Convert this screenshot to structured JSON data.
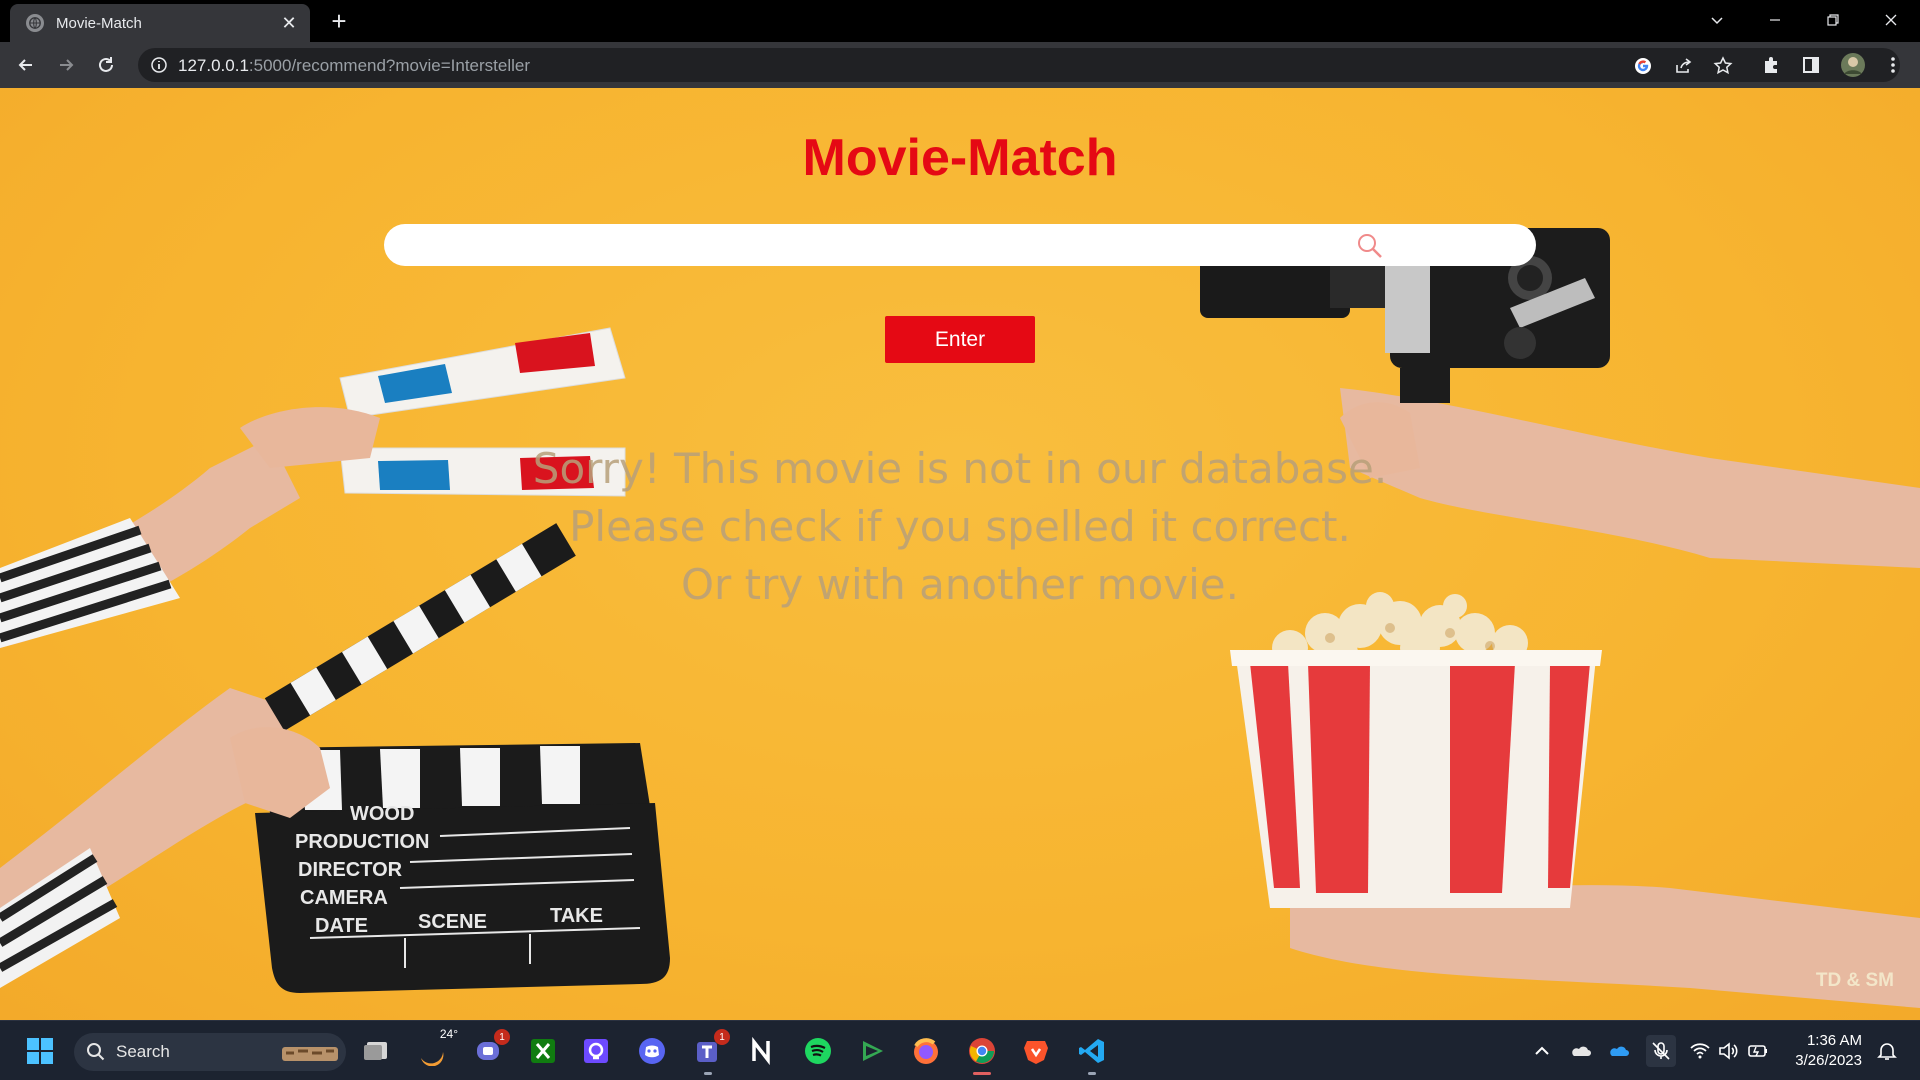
{
  "browser": {
    "tab_title": "Movie-Match",
    "url_host": "127.0.0.1",
    "url_rest": ":5000/recommend?movie=Intersteller"
  },
  "page": {
    "title": "Movie-Match",
    "search_placeholder": "",
    "search_value": "",
    "enter_label": "Enter",
    "message_line1": "Sorry! This movie is not in our database.",
    "message_line2": "Please check if you spelled it correct.",
    "message_line3": "Or try with another movie.",
    "credit": "TD & SM",
    "clapper_lines": [
      "WOOD",
      "PRODUCTION",
      "DIRECTOR",
      "CAMERA",
      "DATE",
      "SCENE",
      "TAKE"
    ]
  },
  "taskbar": {
    "search_label": "Search",
    "weather_temp": "24°",
    "teams_badge": "1",
    "chat_badge": "1",
    "time": "1:36 AM",
    "date": "3/26/2023"
  },
  "colors": {
    "accent": "#e50914",
    "page_bg": "#f7b430",
    "message": "#b8a07a"
  }
}
